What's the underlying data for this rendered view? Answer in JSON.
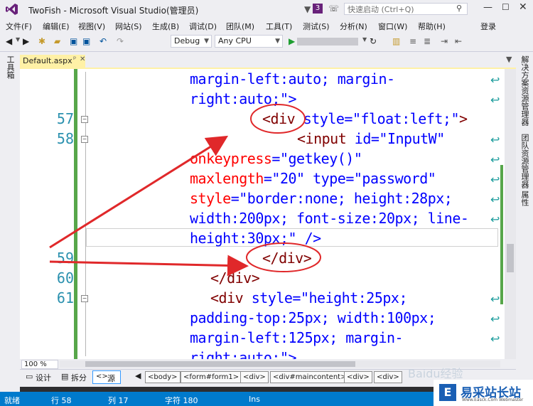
{
  "window": {
    "title": "TwoFish - Microsoft Visual Studio(管理员)",
    "notification_count": "3",
    "quick_launch_placeholder": "快速启动 (Ctrl+Q)",
    "minimize": "—",
    "maximize": "☐",
    "close": "✕"
  },
  "menu": {
    "items": [
      "文件(F)",
      "编辑(E)",
      "视图(V)",
      "网站(S)",
      "生成(B)",
      "调试(D)",
      "团队(M)",
      "工具(T)",
      "测试(S)",
      "分析(N)",
      "窗口(W)",
      "帮助(H)"
    ],
    "login": "登录"
  },
  "toolbar": {
    "config": "Debug",
    "platform": "Any CPU"
  },
  "left_panel": {
    "toolbox": "工具箱"
  },
  "right_panel": {
    "tabs": [
      "解决方案资源管理器",
      "团队资源管理器",
      "属性"
    ]
  },
  "document": {
    "tab_name": "Default.aspx",
    "pin": "ᵖ",
    "close": "✕"
  },
  "code": {
    "lines": [
      {
        "num": "",
        "text": "margin-left:auto; margin-"
      },
      {
        "num": "",
        "text": "right:auto;\">"
      },
      {
        "num": "57",
        "text": "<div style=\"float:left;\">"
      },
      {
        "num": "58",
        "text": "<input id=\"InputW\""
      },
      {
        "num": "",
        "text": "onkeypress=\"getkey()\""
      },
      {
        "num": "",
        "text": "maxlength=\"20\" type=\"password\""
      },
      {
        "num": "",
        "text": "style=\"border:none; height:28px;"
      },
      {
        "num": "",
        "text": "width:200px; font-size:20px; line-"
      },
      {
        "num": "",
        "text": "height:30px;\" />"
      },
      {
        "num": "59",
        "text": "</div>"
      },
      {
        "num": "60",
        "text": "</div>"
      },
      {
        "num": "61",
        "text": "<div style=\"height:25px;"
      },
      {
        "num": "",
        "text": "padding-top:25px; width:100px;"
      },
      {
        "num": "",
        "text": "margin-left:125px; margin-"
      },
      {
        "num": "",
        "text": "right:auto;\">"
      }
    ]
  },
  "editor_footer": {
    "zoom": "100 %",
    "design": "设计",
    "split": "拆分",
    "source": "源",
    "breadcrumbs": [
      "<body>",
      "<form#form1>",
      "<div>",
      "<div#maincontent>",
      "<div>",
      "<div>"
    ]
  },
  "status": {
    "ready": "就绪",
    "row": "行 58",
    "col": "列 17",
    "char": "字符 180",
    "ins": "Ins"
  },
  "watermark": {
    "baidu": "Baidu经验",
    "site": "易采站长站",
    "site_sub": "Www.Easck.Com Webmaster",
    "logo": "E"
  },
  "colors": {
    "accent": "#007acc",
    "annotation": "#e0282a",
    "tag": "#800000",
    "attribute": "#ff0000",
    "value": "#0000ff",
    "line_number": "#2b91af"
  }
}
